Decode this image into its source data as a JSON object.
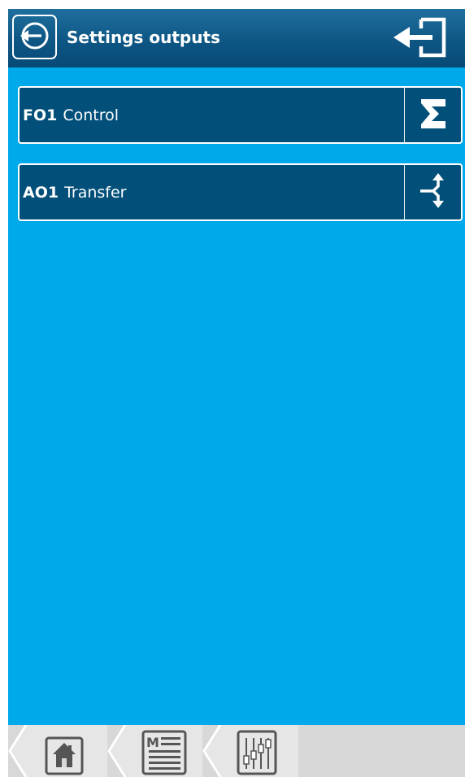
{
  "header": {
    "title": "Settings outputs",
    "back_icon": "back-circle-icon",
    "exit_icon": "exit-icon"
  },
  "menu": {
    "items": [
      {
        "code": "FO1",
        "label": "Control",
        "action_icon": "sigma-icon"
      },
      {
        "code": "AO1",
        "label": "Transfer",
        "action_icon": "transfer-split-icon"
      }
    ]
  },
  "bottom_nav": {
    "items": [
      {
        "icon": "home-icon"
      },
      {
        "icon": "menu-list-icon",
        "glyph": "M"
      },
      {
        "icon": "sliders-icon"
      }
    ]
  },
  "colors": {
    "background": "#00aaea",
    "header": "#0e5684",
    "item": "#02507a",
    "bottom_bar": "#d8d8d8",
    "icon_dark": "#555555"
  }
}
